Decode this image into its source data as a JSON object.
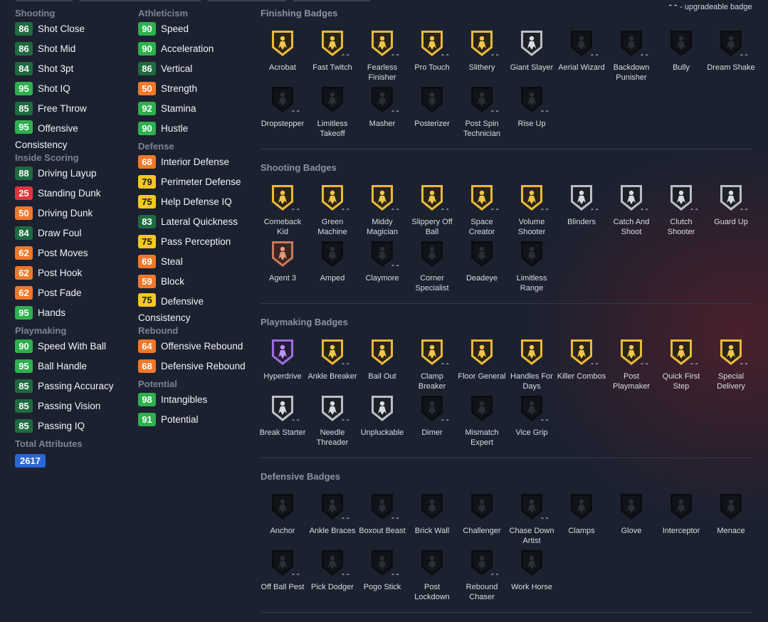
{
  "attributes": {
    "col1": [
      {
        "section": "Shooting",
        "items": [
          {
            "value": "86",
            "name": "Shot Close",
            "color": "dg"
          },
          {
            "value": "86",
            "name": "Shot Mid",
            "color": "dg"
          },
          {
            "value": "84",
            "name": "Shot 3pt",
            "color": "dg"
          },
          {
            "value": "95",
            "name": "Shot IQ",
            "color": "g"
          },
          {
            "value": "85",
            "name": "Free Throw",
            "color": "dg"
          },
          {
            "value": "95",
            "name": "Offensive Consistency",
            "color": "g",
            "wrap": true
          }
        ]
      },
      {
        "section": "Inside Scoring",
        "items": [
          {
            "value": "88",
            "name": "Driving Layup",
            "color": "dg"
          },
          {
            "value": "25",
            "name": "Standing Dunk",
            "color": "r"
          },
          {
            "value": "50",
            "name": "Driving Dunk",
            "color": "o"
          },
          {
            "value": "84",
            "name": "Draw Foul",
            "color": "dg"
          },
          {
            "value": "62",
            "name": "Post Moves",
            "color": "o"
          },
          {
            "value": "62",
            "name": "Post Hook",
            "color": "o"
          },
          {
            "value": "62",
            "name": "Post Fade",
            "color": "o"
          },
          {
            "value": "95",
            "name": "Hands",
            "color": "g"
          }
        ]
      },
      {
        "section": "Playmaking",
        "items": [
          {
            "value": "90",
            "name": "Speed With Ball",
            "color": "g"
          },
          {
            "value": "95",
            "name": "Ball Handle",
            "color": "g"
          },
          {
            "value": "85",
            "name": "Passing Accuracy",
            "color": "dg"
          },
          {
            "value": "85",
            "name": "Passing Vision",
            "color": "dg"
          },
          {
            "value": "85",
            "name": "Passing IQ",
            "color": "dg"
          }
        ]
      }
    ],
    "col2": [
      {
        "section": "Athleticism",
        "items": [
          {
            "value": "90",
            "name": "Speed",
            "color": "g"
          },
          {
            "value": "90",
            "name": "Acceleration",
            "color": "g"
          },
          {
            "value": "86",
            "name": "Vertical",
            "color": "dg"
          },
          {
            "value": "50",
            "name": "Strength",
            "color": "o"
          },
          {
            "value": "92",
            "name": "Stamina",
            "color": "g"
          },
          {
            "value": "90",
            "name": "Hustle",
            "color": "g"
          }
        ]
      },
      {
        "section": "Defense",
        "items": [
          {
            "value": "68",
            "name": "Interior Defense",
            "color": "o"
          },
          {
            "value": "79",
            "name": "Perimeter Defense",
            "color": "y"
          },
          {
            "value": "75",
            "name": "Help Defense IQ",
            "color": "y"
          },
          {
            "value": "83",
            "name": "Lateral Quickness",
            "color": "dg"
          },
          {
            "value": "75",
            "name": "Pass Perception",
            "color": "y"
          },
          {
            "value": "69",
            "name": "Steal",
            "color": "o"
          },
          {
            "value": "59",
            "name": "Block",
            "color": "o"
          },
          {
            "value": "75",
            "name": "Defensive Consistency",
            "color": "y",
            "wrap": true
          }
        ]
      },
      {
        "section": "Rebound",
        "items": [
          {
            "value": "64",
            "name": "Offensive Rebound",
            "color": "o"
          },
          {
            "value": "68",
            "name": "Defensive Rebound",
            "color": "o"
          }
        ]
      },
      {
        "section": "Potential",
        "items": [
          {
            "value": "98",
            "name": "Intangibles",
            "color": "g"
          },
          {
            "value": "91",
            "name": "Potential",
            "color": "g"
          }
        ]
      }
    ],
    "total_label": "Total Attributes",
    "total_value": "2617"
  },
  "legend": {
    "chevron": "^",
    "text": "- upgradeable badge"
  },
  "badge_sections": [
    {
      "title": "Finishing Badges",
      "badges": [
        {
          "name": "Acrobat",
          "tier": "gold",
          "icon": "acrobat-icon",
          "up": false
        },
        {
          "name": "Fast Twitch",
          "tier": "gold",
          "icon": "fast-twitch-icon",
          "up": true
        },
        {
          "name": "Fearless Finisher",
          "tier": "gold",
          "icon": "fearless-finisher-icon",
          "up": true
        },
        {
          "name": "Pro Touch",
          "tier": "gold",
          "icon": "pro-touch-icon",
          "up": true
        },
        {
          "name": "Slithery",
          "tier": "gold",
          "icon": "slithery-icon",
          "up": true
        },
        {
          "name": "Giant Slayer",
          "tier": "silver",
          "icon": "giant-slayer-icon",
          "up": false
        },
        {
          "name": "Aerial Wizard",
          "tier": "locked",
          "icon": "aerial-wizard-icon",
          "up": true
        },
        {
          "name": "Backdown Punisher",
          "tier": "locked",
          "icon": "backdown-punisher-icon",
          "up": true
        },
        {
          "name": "Bully",
          "tier": "locked",
          "icon": "bully-icon",
          "up": false
        },
        {
          "name": "Dream Shake",
          "tier": "locked",
          "icon": "dream-shake-icon",
          "up": true
        },
        {
          "name": "Dropstepper",
          "tier": "locked",
          "icon": "dropstepper-icon",
          "up": true
        },
        {
          "name": "Limitless Takeoff",
          "tier": "locked",
          "icon": "limitless-takeoff-icon",
          "up": false
        },
        {
          "name": "Masher",
          "tier": "locked",
          "icon": "masher-icon",
          "up": true
        },
        {
          "name": "Posterizer",
          "tier": "locked",
          "icon": "posterizer-icon",
          "up": false
        },
        {
          "name": "Post Spin Technician",
          "tier": "locked",
          "icon": "post-spin-technician-icon",
          "up": true
        },
        {
          "name": "Rise Up",
          "tier": "locked",
          "icon": "rise-up-icon",
          "up": true
        }
      ]
    },
    {
      "title": "Shooting Badges",
      "badges": [
        {
          "name": "Comeback Kid",
          "tier": "gold",
          "icon": "comeback-kid-icon",
          "up": true
        },
        {
          "name": "Green Machine",
          "tier": "gold",
          "icon": "green-machine-icon",
          "up": true
        },
        {
          "name": "Middy Magician",
          "tier": "gold",
          "icon": "middy-magician-icon",
          "up": true
        },
        {
          "name": "Slippery Off Ball",
          "tier": "gold",
          "icon": "slippery-off-ball-icon",
          "up": true
        },
        {
          "name": "Space Creator",
          "tier": "gold",
          "icon": "space-creator-icon",
          "up": true
        },
        {
          "name": "Volume Shooter",
          "tier": "gold",
          "icon": "volume-shooter-icon",
          "up": true
        },
        {
          "name": "Blinders",
          "tier": "silver",
          "icon": "blinders-icon",
          "up": true
        },
        {
          "name": "Catch And Shoot",
          "tier": "silver",
          "icon": "catch-and-shoot-icon",
          "up": true
        },
        {
          "name": "Clutch Shooter",
          "tier": "silver",
          "icon": "clutch-shooter-icon",
          "up": true
        },
        {
          "name": "Guard Up",
          "tier": "silver",
          "icon": "guard-up-icon",
          "up": true
        },
        {
          "name": "Agent 3",
          "tier": "bronze",
          "icon": "agent-3-icon",
          "up": false
        },
        {
          "name": "Amped",
          "tier": "locked",
          "icon": "amped-icon",
          "up": false
        },
        {
          "name": "Claymore",
          "tier": "locked",
          "icon": "claymore-icon",
          "up": true
        },
        {
          "name": "Corner Specialist",
          "tier": "locked",
          "icon": "corner-specialist-icon",
          "up": false
        },
        {
          "name": "Deadeye",
          "tier": "locked",
          "icon": "deadeye-icon",
          "up": false
        },
        {
          "name": "Limitless Range",
          "tier": "locked",
          "icon": "limitless-range-icon",
          "up": false
        }
      ]
    },
    {
      "title": "Playmaking Badges",
      "badges": [
        {
          "name": "Hyperdrive",
          "tier": "purple",
          "icon": "hyperdrive-icon",
          "up": false
        },
        {
          "name": "Ankle Breaker",
          "tier": "gold",
          "icon": "ankle-breaker-icon",
          "up": true
        },
        {
          "name": "Bail Out",
          "tier": "gold",
          "icon": "bail-out-icon",
          "up": false
        },
        {
          "name": "Clamp Breaker",
          "tier": "gold",
          "icon": "clamp-breaker-icon",
          "up": true
        },
        {
          "name": "Floor General",
          "tier": "gold",
          "icon": "floor-general-icon",
          "up": false
        },
        {
          "name": "Handles For Days",
          "tier": "gold",
          "icon": "handles-for-days-icon",
          "up": false
        },
        {
          "name": "Killer Combos",
          "tier": "gold",
          "icon": "killer-combos-icon",
          "up": true
        },
        {
          "name": "Post Playmaker",
          "tier": "gold",
          "icon": "post-playmaker-icon",
          "up": true
        },
        {
          "name": "Quick First Step",
          "tier": "gold",
          "icon": "quick-first-step-icon",
          "up": true
        },
        {
          "name": "Special Delivery",
          "tier": "gold",
          "icon": "special-delivery-icon",
          "up": true
        },
        {
          "name": "Break Starter",
          "tier": "silver",
          "icon": "break-starter-icon",
          "up": true
        },
        {
          "name": "Needle Threader",
          "tier": "silver",
          "icon": "needle-threader-icon",
          "up": true
        },
        {
          "name": "Unpluckable",
          "tier": "silver",
          "icon": "unpluckable-icon",
          "up": false
        },
        {
          "name": "Dimer",
          "tier": "locked",
          "icon": "dimer-icon",
          "up": true
        },
        {
          "name": "Mismatch Expert",
          "tier": "locked",
          "icon": "mismatch-expert-icon",
          "up": false
        },
        {
          "name": "Vice Grip",
          "tier": "locked",
          "icon": "vice-grip-icon",
          "up": true
        }
      ]
    },
    {
      "title": "Defensive Badges",
      "badges": [
        {
          "name": "Anchor",
          "tier": "locked",
          "icon": "anchor-icon",
          "up": false
        },
        {
          "name": "Ankle Braces",
          "tier": "locked",
          "icon": "ankle-braces-icon",
          "up": true
        },
        {
          "name": "Boxout Beast",
          "tier": "locked",
          "icon": "boxout-beast-icon",
          "up": true
        },
        {
          "name": "Brick Wall",
          "tier": "locked",
          "icon": "brick-wall-icon",
          "up": false
        },
        {
          "name": "Challenger",
          "tier": "locked",
          "icon": "challenger-icon",
          "up": false
        },
        {
          "name": "Chase Down Artist",
          "tier": "locked",
          "icon": "chase-down-artist-icon",
          "up": true
        },
        {
          "name": "Clamps",
          "tier": "locked",
          "icon": "clamps-icon",
          "up": false
        },
        {
          "name": "Glove",
          "tier": "locked",
          "icon": "glove-icon",
          "up": false
        },
        {
          "name": "Interceptor",
          "tier": "locked",
          "icon": "interceptor-icon",
          "up": false
        },
        {
          "name": "Menace",
          "tier": "locked",
          "icon": "menace-icon",
          "up": false
        },
        {
          "name": "Off Ball Pest",
          "tier": "locked",
          "icon": "off-ball-pest-icon",
          "up": true
        },
        {
          "name": "Pick Dodger",
          "tier": "locked",
          "icon": "pick-dodger-icon",
          "up": true
        },
        {
          "name": "Pogo Stick",
          "tier": "locked",
          "icon": "pogo-stick-icon",
          "up": true
        },
        {
          "name": "Post Lockdown",
          "tier": "locked",
          "icon": "post-lockdown-icon",
          "up": false
        },
        {
          "name": "Rebound Chaser",
          "tier": "locked",
          "icon": "rebound-chaser-icon",
          "up": true
        },
        {
          "name": "Work Horse",
          "tier": "locked",
          "icon": "work-horse-icon",
          "up": false
        }
      ]
    }
  ],
  "tier_colors": {
    "gold": {
      "rim": "#e8b93a",
      "fill": "#2a2418",
      "glyph": "#f1c74a"
    },
    "silver": {
      "rim": "#b9bec6",
      "fill": "#1e2026",
      "glyph": "#d8dce2"
    },
    "bronze": {
      "rim": "#c97a5c",
      "fill": "#3a2622",
      "glyph": "#e39a7a"
    },
    "purple": {
      "rim": "#9c6ee0",
      "fill": "#251c36",
      "glyph": "#b894f0"
    },
    "locked": {
      "rim": "#0b0d12",
      "fill": "#101318",
      "glyph": "#2a2e36"
    }
  }
}
